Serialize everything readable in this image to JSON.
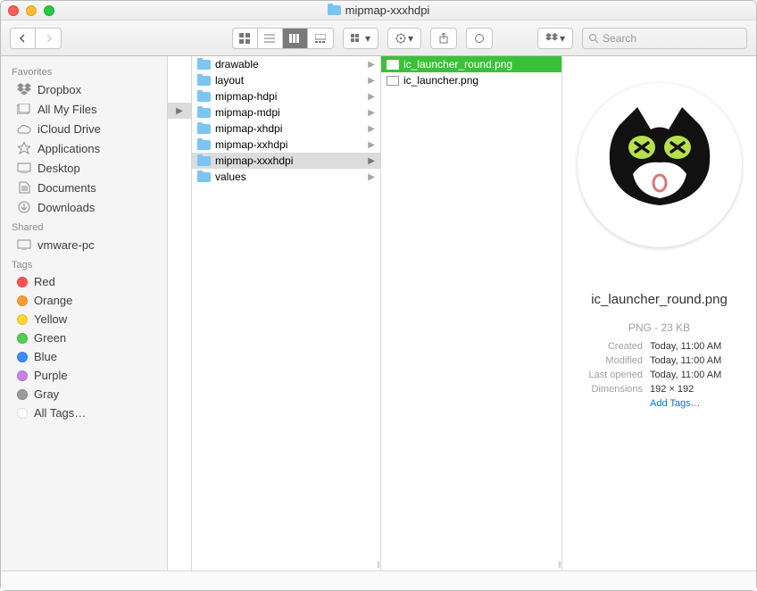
{
  "window": {
    "title": "mipmap-xxxhdpi"
  },
  "search": {
    "placeholder": "Search"
  },
  "sidebar": {
    "sections": [
      {
        "header": "Favorites",
        "items": [
          {
            "icon": "dropbox",
            "label": "Dropbox"
          },
          {
            "icon": "all-files",
            "label": "All My Files"
          },
          {
            "icon": "cloud",
            "label": "iCloud Drive"
          },
          {
            "icon": "apps",
            "label": "Applications"
          },
          {
            "icon": "desktop",
            "label": "Desktop"
          },
          {
            "icon": "documents",
            "label": "Documents"
          },
          {
            "icon": "downloads",
            "label": "Downloads"
          }
        ]
      },
      {
        "header": "Shared",
        "items": [
          {
            "icon": "display",
            "label": "vmware-pc"
          }
        ]
      },
      {
        "header": "Tags",
        "items": [
          {
            "color": "#ff534f",
            "label": "Red"
          },
          {
            "color": "#ff9a33",
            "label": "Orange"
          },
          {
            "color": "#ffd732",
            "label": "Yellow"
          },
          {
            "color": "#4fce4f",
            "label": "Green"
          },
          {
            "color": "#3b8cff",
            "label": "Blue"
          },
          {
            "color": "#c583e6",
            "label": "Purple"
          },
          {
            "color": "#9b9b9b",
            "label": "Gray"
          },
          {
            "color": "",
            "label": "All Tags…"
          }
        ]
      }
    ]
  },
  "columns": {
    "col0": true,
    "col1": [
      {
        "label": "drawable",
        "arrow": true
      },
      {
        "label": "layout",
        "arrow": true
      },
      {
        "label": "mipmap-hdpi",
        "arrow": true
      },
      {
        "label": "mipmap-mdpi",
        "arrow": true
      },
      {
        "label": "mipmap-xhdpi",
        "arrow": true
      },
      {
        "label": "mipmap-xxhdpi",
        "arrow": true
      },
      {
        "label": "mipmap-xxxhdpi",
        "arrow": true,
        "selected": true
      },
      {
        "label": "values",
        "arrow": true
      }
    ],
    "col2": [
      {
        "label": "ic_launcher_round.png",
        "selected": true
      },
      {
        "label": "ic_launcher.png"
      }
    ]
  },
  "preview": {
    "filename": "ic_launcher_round.png",
    "meta": "PNG - 23 KB",
    "rows": [
      {
        "k": "Created",
        "v": "Today, 11:00 AM"
      },
      {
        "k": "Modified",
        "v": "Today, 11:00 AM"
      },
      {
        "k": "Last opened",
        "v": "Today, 11:00 AM"
      },
      {
        "k": "Dimensions",
        "v": "192 × 192"
      }
    ],
    "addTags": "Add Tags…"
  }
}
